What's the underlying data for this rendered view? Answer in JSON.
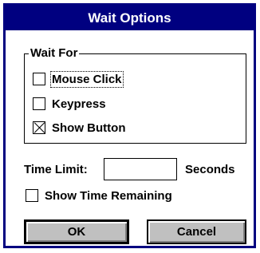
{
  "dialog": {
    "title": "Wait Options",
    "colors": {
      "titlebar": "#000080",
      "button_face": "#c0c0c0"
    }
  },
  "wait_for": {
    "label": "Wait For",
    "options": [
      {
        "label": "Mouse Click",
        "checked": false
      },
      {
        "label": "Keypress",
        "checked": false
      },
      {
        "label": "Show Button",
        "checked": true
      }
    ]
  },
  "time_limit": {
    "label": "Time Limit:",
    "value": "",
    "unit": "Seconds"
  },
  "show_time_remaining": {
    "label": "Show Time Remaining",
    "checked": false
  },
  "buttons": {
    "ok": "OK",
    "cancel": "Cancel"
  }
}
